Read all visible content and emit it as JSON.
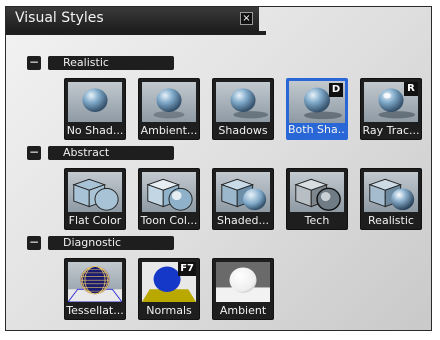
{
  "window": {
    "title": "Visual Styles",
    "close_glyph": "×"
  },
  "groups": [
    {
      "name": "Realistic",
      "collapse_glyph": "−",
      "tiles": [
        {
          "label": "No Shad...",
          "icon": "sphere-no-shadow-icon"
        },
        {
          "label": "Ambient...",
          "icon": "sphere-ambient-icon"
        },
        {
          "label": "Shadows",
          "icon": "sphere-shadows-icon"
        },
        {
          "label": "Both Sha...",
          "icon": "sphere-both-shadows-icon",
          "shortcut": "D",
          "selected": true
        },
        {
          "label": "Ray Trac...",
          "icon": "sphere-ray-traced-icon",
          "shortcut": "R"
        }
      ]
    },
    {
      "name": "Abstract",
      "collapse_glyph": "−",
      "tiles": [
        {
          "label": "Flat Color",
          "icon": "cube-sphere-flat-icon"
        },
        {
          "label": "Toon Col...",
          "icon": "cube-sphere-toon-icon"
        },
        {
          "label": "Shaded...",
          "icon": "cube-sphere-shaded-icon"
        },
        {
          "label": "Tech",
          "icon": "cube-sphere-tech-icon"
        },
        {
          "label": "Realistic",
          "icon": "cube-sphere-realistic-icon"
        }
      ]
    },
    {
      "name": "Diagnostic",
      "collapse_glyph": "−",
      "tiles": [
        {
          "label": "Tessellat...",
          "icon": "wireframe-sphere-icon"
        },
        {
          "label": "Normals",
          "icon": "normals-sphere-icon",
          "shortcut": "F7"
        },
        {
          "label": "Ambient",
          "icon": "white-sphere-ambient-icon"
        }
      ]
    }
  ],
  "colors": {
    "panel_dark": "#1e1e1e",
    "selection_blue": "#2a67d6",
    "sphere_blue": "#7fa9c9",
    "normals_blue": "#1638c8",
    "normals_floor": "#b9a800"
  }
}
